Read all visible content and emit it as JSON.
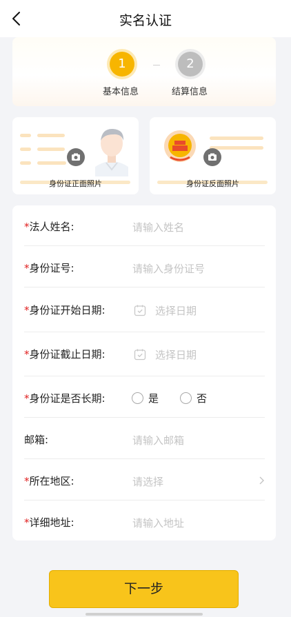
{
  "header": {
    "title": "实名认证",
    "back_icon": "chevron-left-icon"
  },
  "steps": [
    {
      "number": "1",
      "label": "基本信息",
      "active": true,
      "color": "#f7b500"
    },
    {
      "number": "2",
      "label": "结算信息",
      "active": false,
      "color": "#bdbdbd"
    }
  ],
  "id_upload": {
    "front_label": "身份证正面照片",
    "back_label": "身份证反面照片",
    "camera_icon": "camera-icon"
  },
  "form": {
    "required_mark": "*",
    "legal_name": {
      "label": "法人姓名:",
      "placeholder": "请输入姓名",
      "required": true
    },
    "id_number": {
      "label": "身份证号:",
      "placeholder": "请输入身份证号",
      "required": true
    },
    "id_start": {
      "label": "身份证开始日期:",
      "placeholder": "选择日期",
      "required": true
    },
    "id_end": {
      "label": "身份证截止日期:",
      "placeholder": "选择日期",
      "required": true
    },
    "id_long_term": {
      "label": "身份证是否长期:",
      "yes": "是",
      "no": "否",
      "required": true
    },
    "email": {
      "label": "邮箱:",
      "placeholder": "请输入邮箱",
      "required": false
    },
    "region": {
      "label": "所在地区:",
      "placeholder": "请选择",
      "required": true
    },
    "address": {
      "label": "详细地址:",
      "placeholder": "请输入地址",
      "required": true
    }
  },
  "footer": {
    "next_label": "下一步",
    "accent": "#f8c41b"
  }
}
